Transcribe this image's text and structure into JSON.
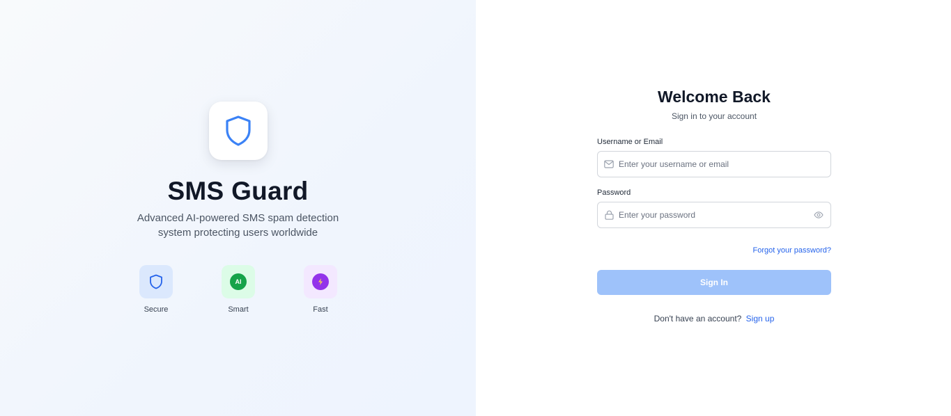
{
  "brand": {
    "title": "SMS Guard",
    "tagline": "Advanced AI-powered SMS spam detection system protecting users worldwide",
    "logo_icon": "shield-icon",
    "accent_color": "#3b82f6"
  },
  "features": [
    {
      "label": "Secure",
      "icon": "shield-icon"
    },
    {
      "label": "Smart",
      "icon": "ai-badge-icon",
      "badge_text": "AI"
    },
    {
      "label": "Fast",
      "icon": "lightning-icon"
    }
  ],
  "login": {
    "title": "Welcome Back",
    "subtitle": "Sign in to your account",
    "username": {
      "label": "Username or Email",
      "placeholder": "Enter your username or email",
      "value": "",
      "icon": "mail-icon"
    },
    "password": {
      "label": "Password",
      "placeholder": "Enter your password",
      "value": "",
      "icon": "lock-icon",
      "toggle_icon": "eye-icon"
    },
    "forgot_label": "Forgot your password?",
    "submit_label": "Sign In",
    "submit_color": "#9ec2fa",
    "signup_prompt": "Don't have an account?",
    "signup_label": "Sign up"
  }
}
